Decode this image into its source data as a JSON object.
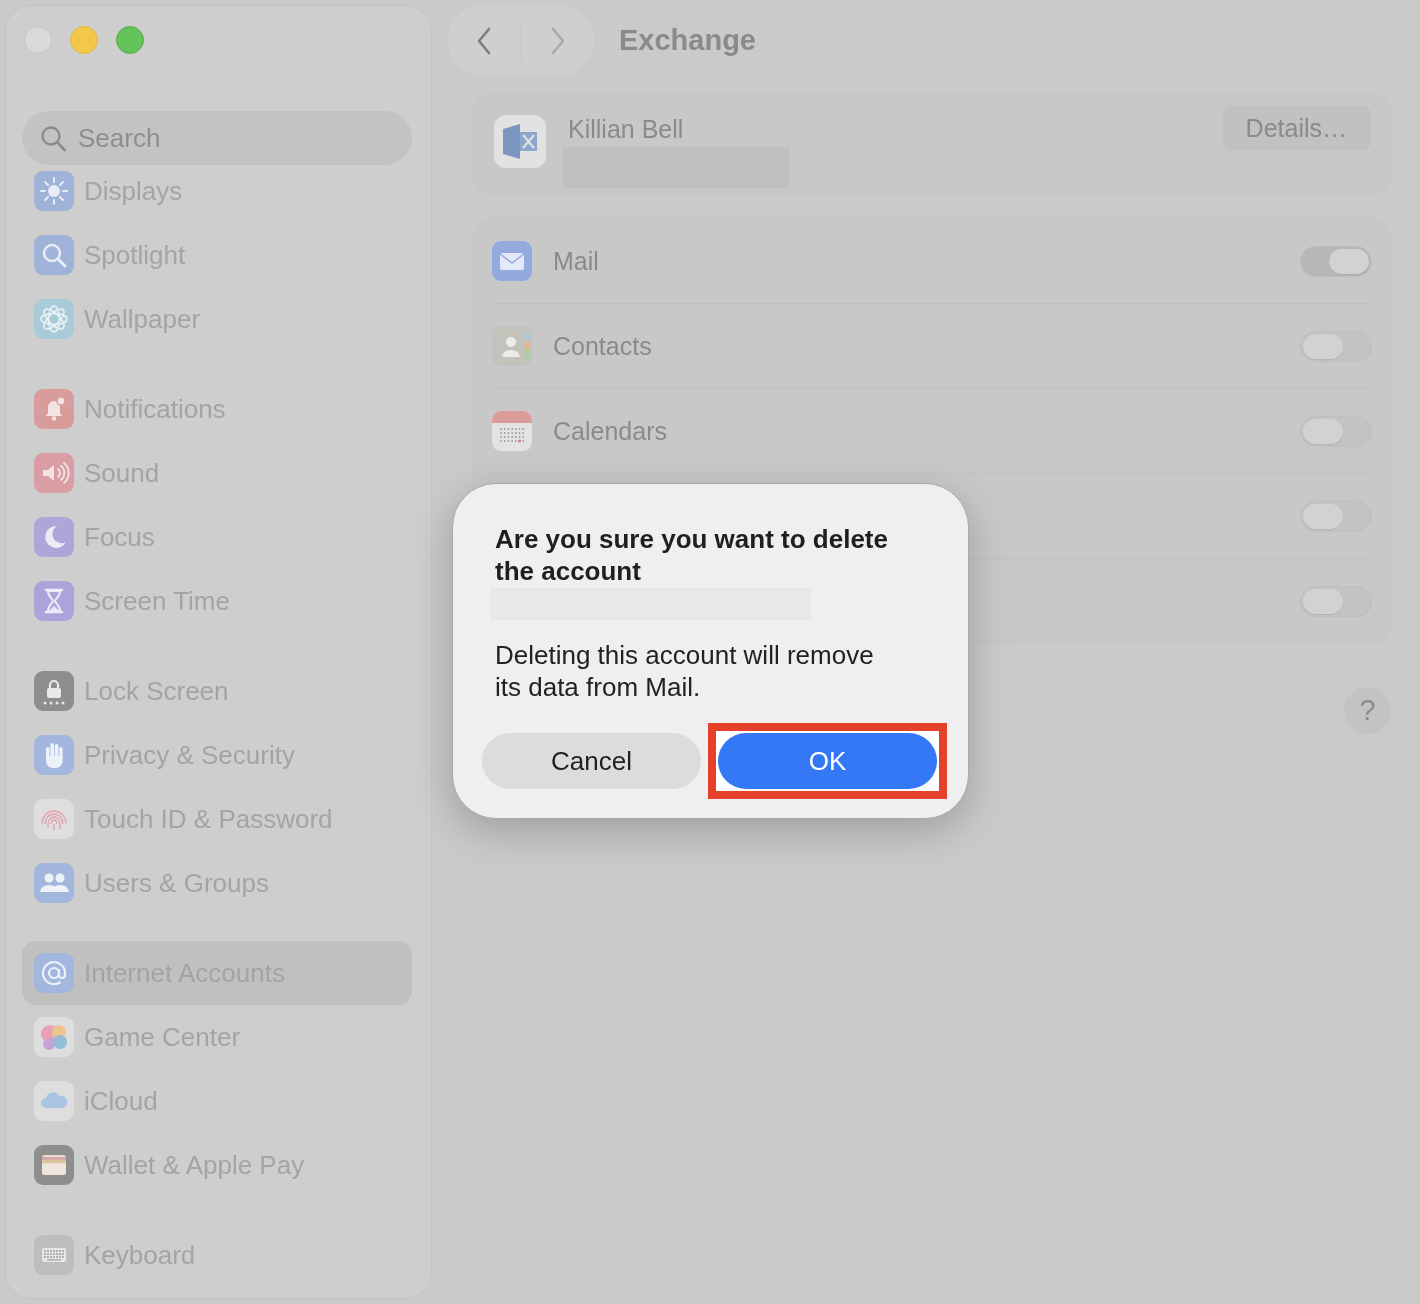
{
  "sidebar": {
    "search": {
      "placeholder": "Search"
    },
    "groups": [
      {
        "items": [
          {
            "label": "Displays",
            "selected": false
          },
          {
            "label": "Spotlight",
            "selected": false
          },
          {
            "label": "Wallpaper",
            "selected": false
          }
        ]
      },
      {
        "items": [
          {
            "label": "Notifications",
            "selected": false
          },
          {
            "label": "Sound",
            "selected": false
          },
          {
            "label": "Focus",
            "selected": false
          },
          {
            "label": "Screen Time",
            "selected": false
          }
        ]
      },
      {
        "items": [
          {
            "label": "Lock Screen",
            "selected": false
          },
          {
            "label": "Privacy & Security",
            "selected": false
          },
          {
            "label": "Touch ID & Password",
            "selected": false
          },
          {
            "label": "Users & Groups",
            "selected": false
          }
        ]
      },
      {
        "items": [
          {
            "label": "Internet Accounts",
            "selected": true
          },
          {
            "label": "Game Center",
            "selected": false
          },
          {
            "label": "iCloud",
            "selected": false
          },
          {
            "label": "Wallet & Apple Pay",
            "selected": false
          }
        ]
      },
      {
        "items": [
          {
            "label": "Keyboard",
            "selected": false
          }
        ]
      }
    ]
  },
  "toolbar": {
    "navigation": [
      {
        "kind": "back",
        "disabled": false
      },
      {
        "kind": "forward",
        "disabled": true
      }
    ],
    "title": "Exchange"
  },
  "account": {
    "name": "Killian Bell",
    "details_button": "Details…"
  },
  "services": [
    {
      "label": "Mail",
      "on": true
    },
    {
      "label": "Contacts",
      "on": false
    },
    {
      "label": "Calendars",
      "on": false
    },
    {
      "on": false
    },
    {
      "on": false
    }
  ],
  "help_button": "?",
  "dialog": {
    "title": "Are you sure you want to delete the account",
    "message": "Deleting this account will remove its data from Mail.",
    "buttons": [
      {
        "label": "Cancel",
        "kind": "secondary",
        "highlighted": false
      },
      {
        "label": "OK",
        "kind": "primary",
        "highlighted": true
      }
    ]
  }
}
